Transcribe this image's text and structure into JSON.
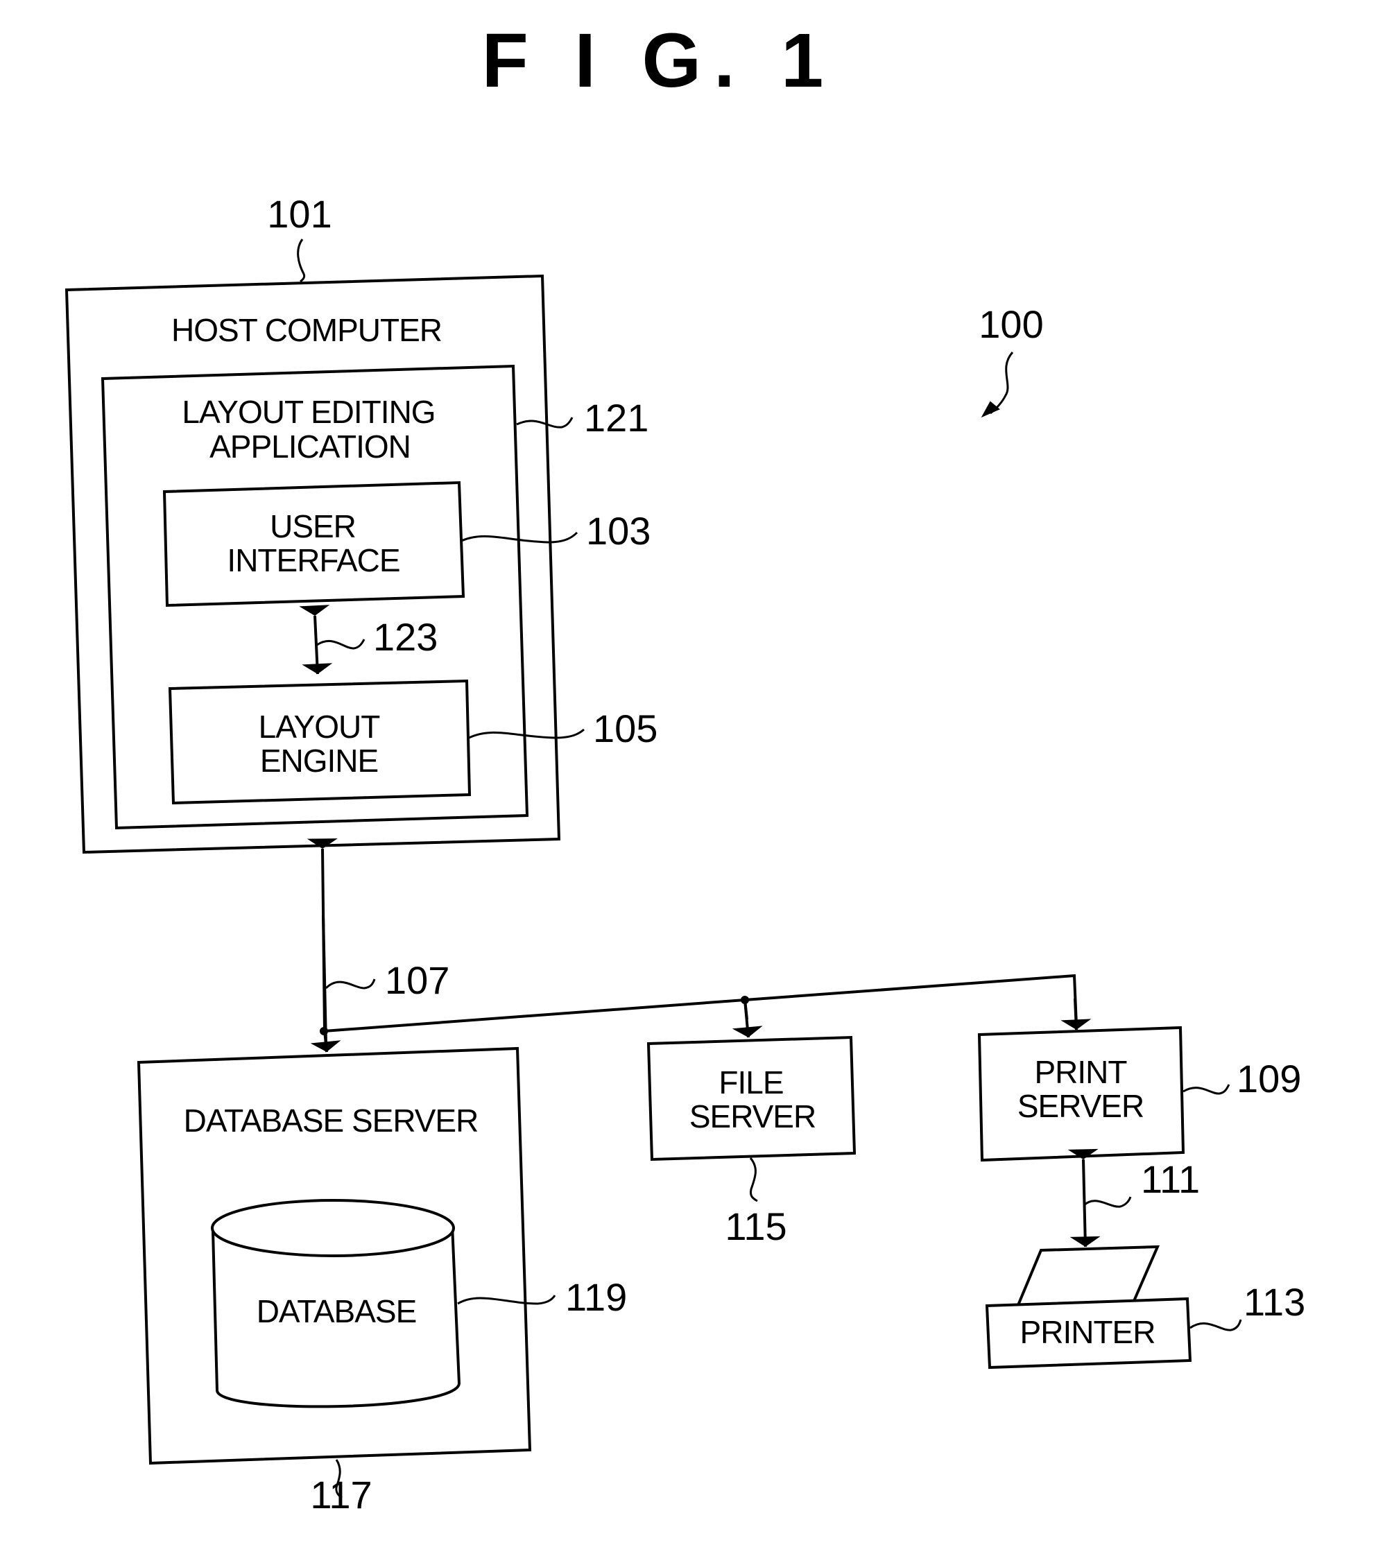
{
  "figure": {
    "title": "F I G. 1",
    "system_ref": "100"
  },
  "components": {
    "host_computer": {
      "label": "HOST COMPUTER",
      "ref": "101"
    },
    "layout_editing_application": {
      "label_lines": [
        "LAYOUT EDITING",
        "APPLICATION"
      ],
      "ref": "121"
    },
    "user_interface": {
      "label_lines": [
        "USER",
        "INTERFACE"
      ],
      "ref": "103"
    },
    "layout_engine": {
      "label_lines": [
        "LAYOUT",
        "ENGINE"
      ],
      "ref": "105"
    },
    "database_server": {
      "label": "DATABASE SERVER",
      "ref": "117"
    },
    "database": {
      "label": "DATABASE",
      "ref": "119"
    },
    "file_server": {
      "label_lines": [
        "FILE",
        "SERVER"
      ],
      "ref": "115"
    },
    "print_server": {
      "label_lines": [
        "PRINT",
        "SERVER"
      ],
      "ref": "109"
    },
    "printer": {
      "label": "PRINTER",
      "ref": "113"
    }
  },
  "connections": {
    "ui_engine_link": {
      "ref": "123",
      "from": "USER INTERFACE",
      "to": "LAYOUT ENGINE",
      "type": "bidirectional"
    },
    "network": {
      "ref": "107",
      "from": "HOST COMPUTER",
      "to": [
        "DATABASE SERVER",
        "FILE SERVER",
        "PRINT SERVER"
      ]
    },
    "print_link": {
      "ref": "111",
      "from": "PRINT SERVER",
      "to": "PRINTER",
      "type": "bidirectional"
    }
  }
}
